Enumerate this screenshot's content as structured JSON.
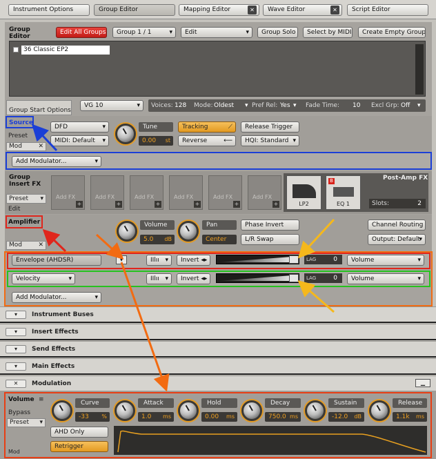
{
  "tabs": [
    {
      "label": "Instrument Options"
    },
    {
      "label": "Group Editor"
    },
    {
      "label": "Mapping Editor"
    },
    {
      "label": "Wave Editor"
    },
    {
      "label": "Script Editor"
    }
  ],
  "group_editor": {
    "title_line1": "Group",
    "title_line2": "Editor",
    "edit_all_groups": "Edit All Groups",
    "group_select": "Group 1 / 1",
    "edit_select": "Edit",
    "group_solo": "Group Solo",
    "select_by_midi": "Select by MIDI",
    "create_empty_group": "Create Empty Group",
    "group_list_item": "36 Classic EP2"
  },
  "group_start": {
    "tab_label": "Group Start Options",
    "vg": "VG 10",
    "voices_label": "Voices:",
    "voices_value": "128",
    "mode_label": "Mode:",
    "mode_value": "Oldest",
    "pref_rel_label": "Pref Rel:",
    "pref_rel_value": "Yes",
    "fade_time_label": "Fade Time:",
    "fade_time_value": "10",
    "excl_grp_label": "Excl Grp:",
    "excl_grp_value": "Off"
  },
  "source": {
    "label": "Source",
    "preset": "Preset",
    "mod": "Mod",
    "dfd": "DFD",
    "midi": "MIDI: Default",
    "tune_label": "Tune",
    "tune_value": "0.00",
    "tune_unit": "st",
    "tracking": "Tracking",
    "reverse": "Reverse",
    "release_trigger": "Release Trigger",
    "hqi": "HQI: Standard",
    "add_modulator": "Add Modulator..."
  },
  "insert_fx": {
    "label_line1": "Group",
    "label_line2": "Insert FX",
    "preset": "Preset",
    "edit": "Edit",
    "slot_label": "Add FX",
    "post_amp_title": "Post-Amp FX",
    "lp2": "LP2",
    "eq1": "EQ 1",
    "slots_label": "Slots:",
    "slots_value": "2"
  },
  "amplifier": {
    "label": "Amplifier",
    "mod": "Mod",
    "volume_label": "Volume",
    "volume_value": "5.0",
    "volume_unit": "dB",
    "pan_label": "Pan",
    "pan_value": "Center",
    "phase_invert": "Phase Invert",
    "lr_swap": "L/R Swap",
    "channel_routing": "Channel Routing",
    "output": "Output: Default",
    "row1_source": "Envelope (AHDSR)",
    "row2_source": "Velocity",
    "invert": "Invert",
    "lag_label": "LAG",
    "lag_value": "0",
    "target": "Volume",
    "add_modulator": "Add Modulator..."
  },
  "sections": [
    {
      "name": "Instrument Buses"
    },
    {
      "name": "Insert Effects"
    },
    {
      "name": "Send Effects"
    },
    {
      "name": "Main Effects"
    },
    {
      "name": "Modulation"
    }
  ],
  "envelope": {
    "label": "Volume",
    "bypass": "Bypass",
    "preset": "Preset",
    "mod": "Mod",
    "ahd_only": "AHD Only",
    "retrigger": "Retrigger",
    "params": [
      {
        "label": "Curve",
        "value": "-33",
        "unit": "%"
      },
      {
        "label": "Attack",
        "value": "1.0",
        "unit": "ms"
      },
      {
        "label": "Hold",
        "value": "0.00",
        "unit": "ms"
      },
      {
        "label": "Decay",
        "value": "750.0",
        "unit": "ms"
      },
      {
        "label": "Sustain",
        "value": "-12.0",
        "unit": "dB"
      },
      {
        "label": "Release",
        "value": "1.1k",
        "unit": "ms"
      }
    ]
  }
}
